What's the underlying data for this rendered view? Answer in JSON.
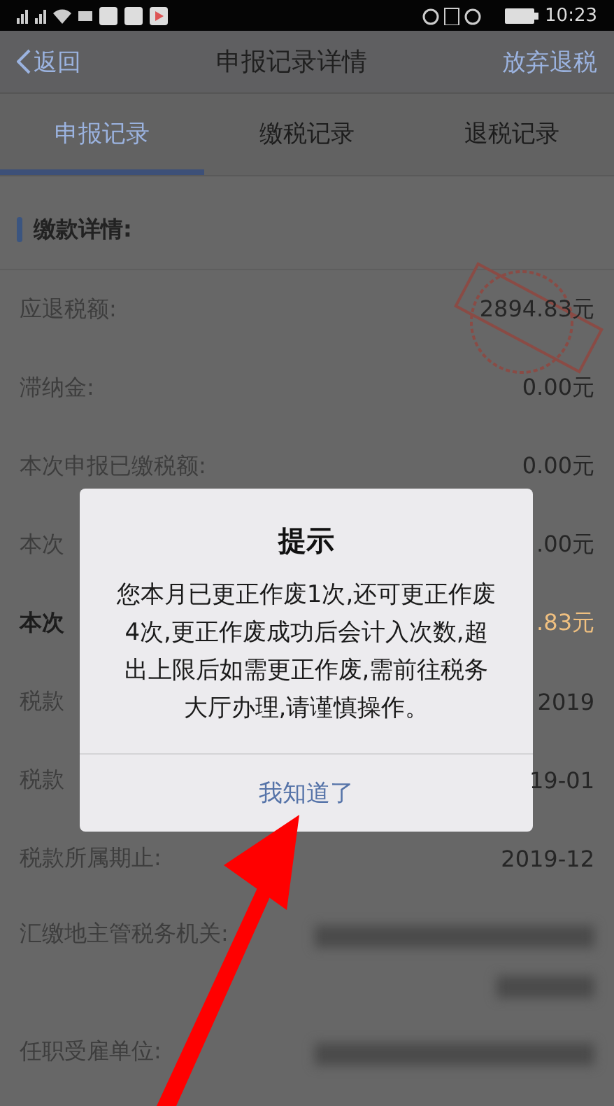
{
  "status_bar": {
    "time": "10:23"
  },
  "nav": {
    "back": "返回",
    "title": "申报记录详情",
    "action": "放弃退税"
  },
  "tabs": [
    {
      "label": "申报记录",
      "selected": true
    },
    {
      "label": "缴税记录",
      "selected": false
    },
    {
      "label": "退税记录",
      "selected": false
    }
  ],
  "section": {
    "title": "缴款详情:"
  },
  "rows": [
    {
      "kind": "amount",
      "label": "应退税额:",
      "value": "2894.83元"
    },
    {
      "kind": "amount",
      "label": "滞纳金:",
      "value": "0.00元"
    },
    {
      "kind": "amount",
      "label": "本次申报已缴税额:",
      "value": "0.00元"
    },
    {
      "kind": "amount",
      "label": "本次",
      "value": ".00元"
    },
    {
      "kind": "highlight",
      "label": "本次",
      "value": ".83元"
    },
    {
      "kind": "amount",
      "label": "税款",
      "value": "2019"
    },
    {
      "kind": "amount",
      "label": "税款",
      "value": "19-01"
    },
    {
      "kind": "amount",
      "label": "税款所属期止:",
      "value": "2019-12"
    },
    {
      "kind": "redacted",
      "label": "汇缴地主管税务机关:"
    },
    {
      "kind": "redacted",
      "label": "任职受雇单位:"
    }
  ],
  "dialog": {
    "title": "提示",
    "message": "您本月已更正作废1次,还可更正作废4次,更正作废成功后会计入次数,超出上限后如需更正作废,需前往税务大厅办理,请谨慎操作。",
    "button": "我知道了"
  }
}
